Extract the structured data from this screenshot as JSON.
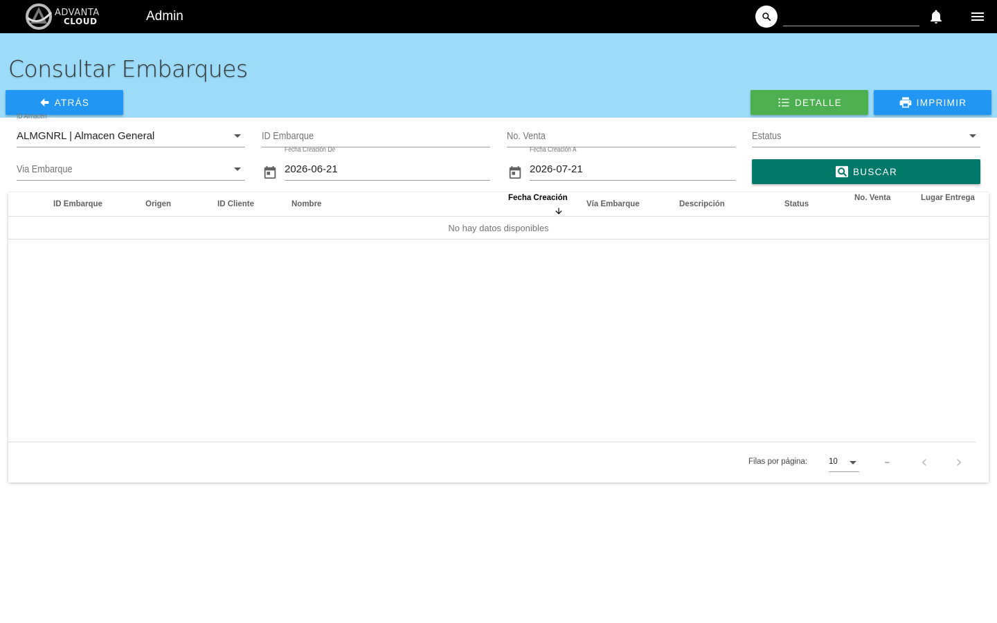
{
  "topbar": {
    "logo_line1": "ADVANTA",
    "logo_line2": "CLOUD",
    "title": "Admin",
    "search_placeholder": "",
    "icons": [
      "search-icon",
      "bell-icon",
      "menu-icon"
    ]
  },
  "header": {
    "page_title": "Consultar Embarques",
    "back_label": "ATRÁS",
    "detail_label": "DETALLE",
    "print_label": "IMPRIMIR"
  },
  "filters": {
    "almacen": {
      "label": "ID Almacén",
      "value": "ALMGNRL | Almacen General"
    },
    "embarque": {
      "placeholder": "ID Embarque"
    },
    "venta": {
      "placeholder": "No. Venta"
    },
    "estatus": {
      "placeholder": "Estatus"
    },
    "via": {
      "placeholder": "Via Embarque"
    },
    "fecha_de": {
      "label": "Fecha Creación De",
      "value": "2026-06-21"
    },
    "fecha_a": {
      "label": "Fecha Creación A",
      "value": "2026-07-21"
    },
    "search_label": "BUSCAR"
  },
  "table": {
    "columns": [
      "ID Embarque",
      "Origen",
      "ID Cliente",
      "Nombre",
      "Fecha Creación",
      "Vía Embarque",
      "Descripción",
      "Status",
      "No. Venta",
      "Lugar Entrega"
    ],
    "sorted_column": "Fecha Creación",
    "sort_direction": "desc",
    "empty_message": "No hay datos disponibles",
    "rows": []
  },
  "pagination": {
    "rows_per_page_label": "Filas por página:",
    "rows_per_page": "10",
    "range": "–"
  },
  "colors": {
    "topbar": "#000000",
    "header_band": "#9ddcf9",
    "primary_blue": "#2196f3",
    "detail_green": "#4caf50",
    "search_teal": "#00796b"
  }
}
